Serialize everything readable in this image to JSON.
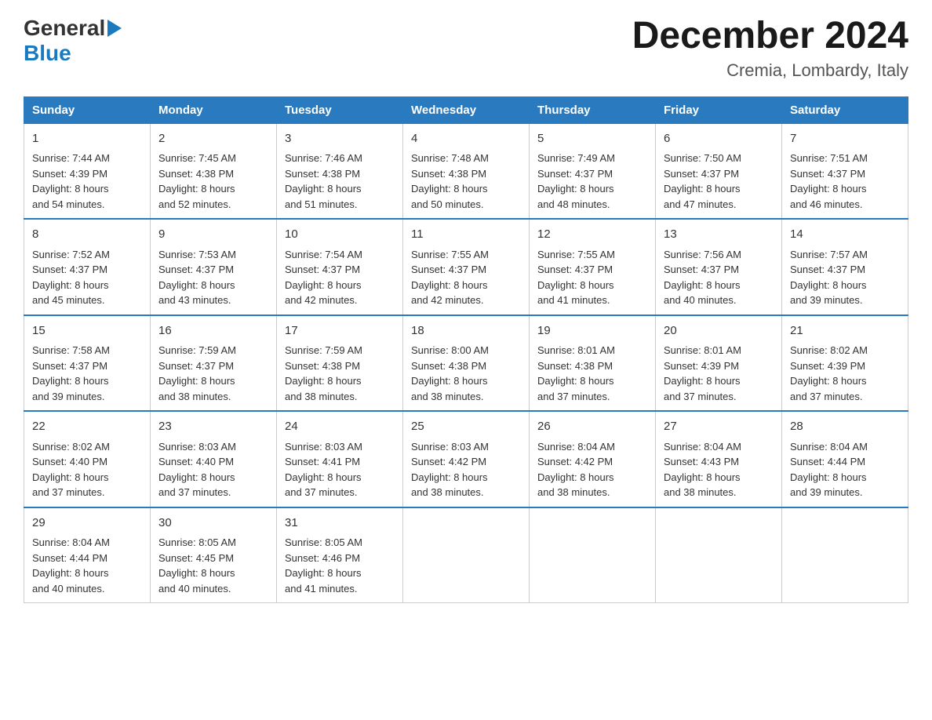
{
  "logo": {
    "general": "General",
    "blue": "Blue"
  },
  "title": {
    "month": "December 2024",
    "location": "Cremia, Lombardy, Italy"
  },
  "headers": [
    "Sunday",
    "Monday",
    "Tuesday",
    "Wednesday",
    "Thursday",
    "Friday",
    "Saturday"
  ],
  "weeks": [
    [
      {
        "day": "1",
        "sunrise": "7:44 AM",
        "sunset": "4:39 PM",
        "daylight": "8 hours and 54 minutes."
      },
      {
        "day": "2",
        "sunrise": "7:45 AM",
        "sunset": "4:38 PM",
        "daylight": "8 hours and 52 minutes."
      },
      {
        "day": "3",
        "sunrise": "7:46 AM",
        "sunset": "4:38 PM",
        "daylight": "8 hours and 51 minutes."
      },
      {
        "day": "4",
        "sunrise": "7:48 AM",
        "sunset": "4:38 PM",
        "daylight": "8 hours and 50 minutes."
      },
      {
        "day": "5",
        "sunrise": "7:49 AM",
        "sunset": "4:37 PM",
        "daylight": "8 hours and 48 minutes."
      },
      {
        "day": "6",
        "sunrise": "7:50 AM",
        "sunset": "4:37 PM",
        "daylight": "8 hours and 47 minutes."
      },
      {
        "day": "7",
        "sunrise": "7:51 AM",
        "sunset": "4:37 PM",
        "daylight": "8 hours and 46 minutes."
      }
    ],
    [
      {
        "day": "8",
        "sunrise": "7:52 AM",
        "sunset": "4:37 PM",
        "daylight": "8 hours and 45 minutes."
      },
      {
        "day": "9",
        "sunrise": "7:53 AM",
        "sunset": "4:37 PM",
        "daylight": "8 hours and 43 minutes."
      },
      {
        "day": "10",
        "sunrise": "7:54 AM",
        "sunset": "4:37 PM",
        "daylight": "8 hours and 42 minutes."
      },
      {
        "day": "11",
        "sunrise": "7:55 AM",
        "sunset": "4:37 PM",
        "daylight": "8 hours and 42 minutes."
      },
      {
        "day": "12",
        "sunrise": "7:55 AM",
        "sunset": "4:37 PM",
        "daylight": "8 hours and 41 minutes."
      },
      {
        "day": "13",
        "sunrise": "7:56 AM",
        "sunset": "4:37 PM",
        "daylight": "8 hours and 40 minutes."
      },
      {
        "day": "14",
        "sunrise": "7:57 AM",
        "sunset": "4:37 PM",
        "daylight": "8 hours and 39 minutes."
      }
    ],
    [
      {
        "day": "15",
        "sunrise": "7:58 AM",
        "sunset": "4:37 PM",
        "daylight": "8 hours and 39 minutes."
      },
      {
        "day": "16",
        "sunrise": "7:59 AM",
        "sunset": "4:37 PM",
        "daylight": "8 hours and 38 minutes."
      },
      {
        "day": "17",
        "sunrise": "7:59 AM",
        "sunset": "4:38 PM",
        "daylight": "8 hours and 38 minutes."
      },
      {
        "day": "18",
        "sunrise": "8:00 AM",
        "sunset": "4:38 PM",
        "daylight": "8 hours and 38 minutes."
      },
      {
        "day": "19",
        "sunrise": "8:01 AM",
        "sunset": "4:38 PM",
        "daylight": "8 hours and 37 minutes."
      },
      {
        "day": "20",
        "sunrise": "8:01 AM",
        "sunset": "4:39 PM",
        "daylight": "8 hours and 37 minutes."
      },
      {
        "day": "21",
        "sunrise": "8:02 AM",
        "sunset": "4:39 PM",
        "daylight": "8 hours and 37 minutes."
      }
    ],
    [
      {
        "day": "22",
        "sunrise": "8:02 AM",
        "sunset": "4:40 PM",
        "daylight": "8 hours and 37 minutes."
      },
      {
        "day": "23",
        "sunrise": "8:03 AM",
        "sunset": "4:40 PM",
        "daylight": "8 hours and 37 minutes."
      },
      {
        "day": "24",
        "sunrise": "8:03 AM",
        "sunset": "4:41 PM",
        "daylight": "8 hours and 37 minutes."
      },
      {
        "day": "25",
        "sunrise": "8:03 AM",
        "sunset": "4:42 PM",
        "daylight": "8 hours and 38 minutes."
      },
      {
        "day": "26",
        "sunrise": "8:04 AM",
        "sunset": "4:42 PM",
        "daylight": "8 hours and 38 minutes."
      },
      {
        "day": "27",
        "sunrise": "8:04 AM",
        "sunset": "4:43 PM",
        "daylight": "8 hours and 38 minutes."
      },
      {
        "day": "28",
        "sunrise": "8:04 AM",
        "sunset": "4:44 PM",
        "daylight": "8 hours and 39 minutes."
      }
    ],
    [
      {
        "day": "29",
        "sunrise": "8:04 AM",
        "sunset": "4:44 PM",
        "daylight": "8 hours and 40 minutes."
      },
      {
        "day": "30",
        "sunrise": "8:05 AM",
        "sunset": "4:45 PM",
        "daylight": "8 hours and 40 minutes."
      },
      {
        "day": "31",
        "sunrise": "8:05 AM",
        "sunset": "4:46 PM",
        "daylight": "8 hours and 41 minutes."
      },
      null,
      null,
      null,
      null
    ]
  ],
  "labels": {
    "sunrise": "Sunrise:",
    "sunset": "Sunset:",
    "daylight": "Daylight:"
  }
}
